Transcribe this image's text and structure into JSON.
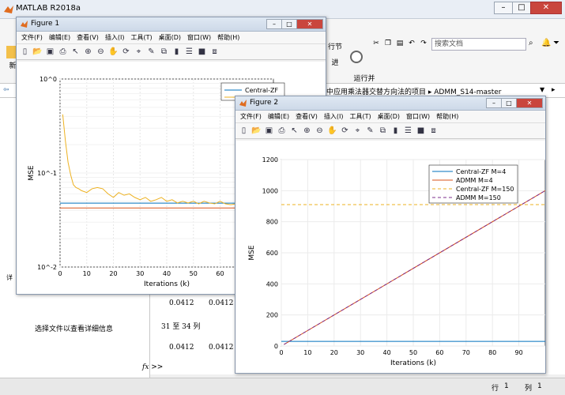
{
  "app": {
    "title": "MATLAB R2018a",
    "search_placeholder": "搜索文档",
    "path": "中应用乘法器交替方向法的项目 ▸ ADMM_S14-master"
  },
  "ribbon": {
    "run_section": "行节",
    "run_advance": "运行并\n计时",
    "left_label": "新",
    "small": "进"
  },
  "left_panel": {
    "detail_label": "选择文件以查看详细信息",
    "tab": "详"
  },
  "command_window": {
    "lines": [
      "0.0412",
      "0.0412",
      "31 至 34 列",
      "0.0412",
      "0.0412"
    ],
    "prompt": "fx >>"
  },
  "status": {
    "row_label": "行",
    "row": "1",
    "col_label": "列",
    "col": "1"
  },
  "figure1": {
    "title": "Figure 1",
    "menu": [
      "文件(F)",
      "编辑(E)",
      "查看(V)",
      "插入(I)",
      "工具(T)",
      "桌面(D)",
      "窗口(W)",
      "帮助(H)"
    ]
  },
  "figure2": {
    "title": "Figure 2",
    "menu": [
      "文件(F)",
      "编辑(E)",
      "查看(V)",
      "插入(I)",
      "工具(T)",
      "桌面(D)",
      "窗口(W)",
      "帮助(H)"
    ]
  },
  "chart_data": [
    {
      "type": "line",
      "ylabel": "MSE",
      "xlabel": "Iterations (k)",
      "yscale": "log",
      "ylim": [
        0.01,
        1
      ],
      "xlim": [
        0,
        80
      ],
      "x_ticks": [
        "0",
        "10",
        "20",
        "30",
        "40",
        "50",
        "60",
        "70"
      ],
      "y_ticks": [
        "10^0",
        "10^-1",
        "10^-2"
      ],
      "legend": [
        "Central-ZF"
      ],
      "legend_position": "top-right",
      "grid": true,
      "series": [
        {
          "name": "Central-ZF",
          "color": "#0072bd",
          "x": [
            0,
            80
          ],
          "y": [
            0.0478,
            0.0478
          ]
        },
        {
          "name": "",
          "color": "#edb120",
          "x": [
            1,
            2,
            3,
            4,
            5,
            6,
            7,
            8,
            10,
            12,
            14,
            16,
            18,
            20,
            22,
            24,
            26,
            28,
            30,
            32,
            34,
            36,
            38,
            40,
            42,
            44,
            46,
            48,
            50,
            52,
            54,
            56,
            58,
            60,
            62,
            64,
            66,
            68,
            70,
            72,
            74,
            76,
            78,
            80
          ],
          "y": [
            0.42,
            0.22,
            0.13,
            0.095,
            0.075,
            0.07,
            0.068,
            0.065,
            0.062,
            0.068,
            0.07,
            0.068,
            0.06,
            0.055,
            0.062,
            0.058,
            0.06,
            0.055,
            0.052,
            0.055,
            0.05,
            0.052,
            0.055,
            0.05,
            0.052,
            0.048,
            0.05,
            0.048,
            0.05,
            0.047,
            0.05,
            0.048,
            0.047,
            0.05,
            0.047,
            0.046,
            0.047,
            0.045,
            0.046,
            0.045,
            0.046,
            0.045,
            0.045,
            0.045
          ]
        },
        {
          "name": "",
          "color": "#d95319",
          "x": [
            0,
            80
          ],
          "y": [
            0.0425,
            0.0425
          ]
        }
      ]
    },
    {
      "type": "line",
      "ylabel": "MSE",
      "xlabel": "Iterations (k)",
      "ylim": [
        0,
        1200
      ],
      "xlim": [
        0,
        100
      ],
      "x_ticks": [
        "0",
        "10",
        "20",
        "30",
        "40",
        "50",
        "60",
        "70",
        "80",
        "90"
      ],
      "y_ticks": [
        "0",
        "200",
        "400",
        "600",
        "800",
        "1000",
        "1200"
      ],
      "legend": [
        "Central-ZF M=4",
        "ADMM M=4",
        "Central-ZF M=150",
        "ADMM M=150"
      ],
      "legend_position": "top-right",
      "grid": true,
      "series": [
        {
          "name": "Central-ZF M=4",
          "color": "#0072bd",
          "dash": "none",
          "x": [
            0,
            100
          ],
          "y": [
            30,
            30
          ]
        },
        {
          "name": "ADMM M=4",
          "color": "#d95319",
          "dash": "none",
          "x": [
            1,
            100
          ],
          "y": [
            10,
            1000
          ]
        },
        {
          "name": "Central-ZF M=150",
          "color": "#edb120",
          "dash": "4,3",
          "x": [
            0,
            100
          ],
          "y": [
            910,
            910
          ]
        },
        {
          "name": "ADMM M=150",
          "color": "#7e2f8e",
          "dash": "4,3",
          "x": [
            1,
            100
          ],
          "y": [
            10,
            1000
          ]
        }
      ]
    }
  ]
}
